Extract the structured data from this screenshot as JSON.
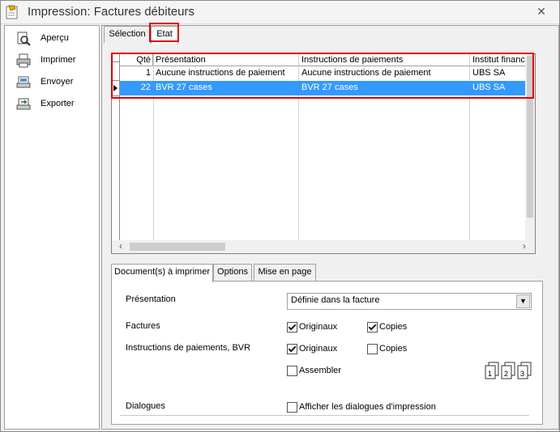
{
  "window": {
    "title": "Impression: Factures débiteurs",
    "close_symbol": "✕"
  },
  "sidebar": {
    "items": [
      {
        "label": "Aperçu",
        "icon": "preview-icon"
      },
      {
        "label": "Imprimer",
        "icon": "printer-icon"
      },
      {
        "label": "Envoyer",
        "icon": "send-icon"
      },
      {
        "label": "Exporter",
        "icon": "export-icon"
      }
    ]
  },
  "tabs": {
    "selection": "Sélection",
    "etat": "Etat"
  },
  "grid": {
    "columns": [
      "Qté",
      "Présentation",
      "Instructions de paiements",
      "Institut financier"
    ],
    "rows": [
      {
        "qty": "1",
        "presentation": "Aucune instructions de paiement",
        "instructions": "Aucune instructions de paiement",
        "institut": "UBS SA",
        "selected": false
      },
      {
        "qty": "22",
        "presentation": "BVR 27 cases",
        "instructions": "BVR 27 cases",
        "institut": "UBS SA",
        "selected": true
      }
    ]
  },
  "subtabs": {
    "documents": "Document(s) à imprimer",
    "options": "Options",
    "mise_en_page": "Mise en page"
  },
  "form": {
    "presentation_label": "Présentation",
    "presentation_value": "Définie dans la facture",
    "factures_label": "Factures",
    "factures_originaux": "Originaux",
    "factures_copies": "Copies",
    "instructions_label": "Instructions de paiements, BVR",
    "instr_originaux": "Originaux",
    "instr_copies": "Copies",
    "assembler": "Assembler",
    "dialogues_label": "Dialogues",
    "afficher_dialogues": "Afficher les dialogues d'impression",
    "checks": {
      "factures_originaux": true,
      "factures_copies": true,
      "instr_originaux": true,
      "instr_copies": false,
      "assembler": false,
      "afficher_dialogues": false
    }
  }
}
